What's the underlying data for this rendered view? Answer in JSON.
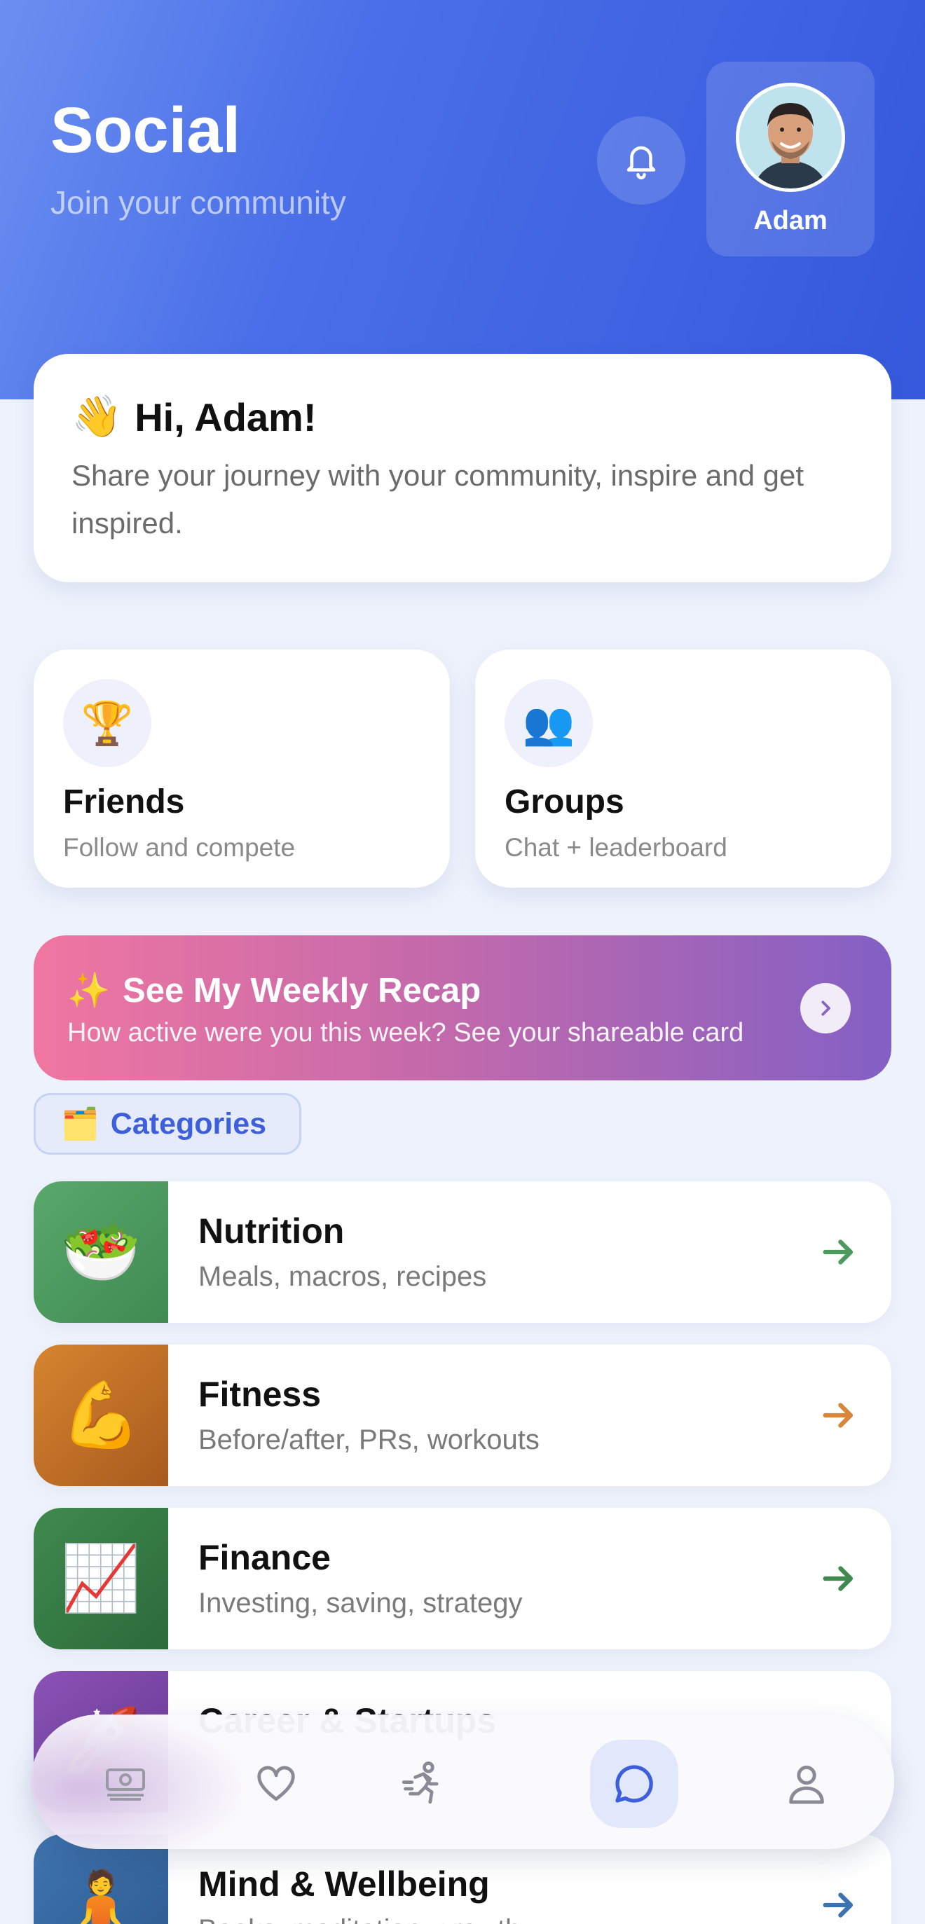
{
  "header": {
    "title": "Social",
    "subtitle": "Join your community",
    "profile_name": "Adam",
    "bell_icon": "bell-icon"
  },
  "greeting": {
    "emoji": "👋",
    "title": "Hi, Adam!",
    "text": "Share your journey with your community, inspire and get inspired."
  },
  "quick_cards": [
    {
      "icon": "🏆",
      "title": "Friends",
      "subtitle": "Follow and compete"
    },
    {
      "icon": "👥",
      "title": "Groups",
      "subtitle": "Chat + leaderboard"
    }
  ],
  "recap": {
    "emoji": "✨",
    "title": "See My Weekly Recap",
    "subtitle": "How active were you this week? See your shareable card"
  },
  "categories_label": "Categories",
  "categories_icon": "🗂️",
  "categories": [
    {
      "emoji": "🥗",
      "title": "Nutrition",
      "subtitle": "Meals, macros, recipes",
      "color": "#4f9e62",
      "arrow_color": "#4c9a5e"
    },
    {
      "emoji": "💪",
      "title": "Fitness",
      "subtitle": "Before/after, PRs, workouts",
      "color": "#c9782a",
      "arrow_color": "#d9853a"
    },
    {
      "emoji": "📈",
      "title": "Finance",
      "subtitle": "Investing, saving, strategy",
      "color": "#3c7f4a",
      "arrow_color": "#3f8a4e"
    },
    {
      "emoji": "🚀",
      "title": "Career & Startups",
      "subtitle": "",
      "color": "#7a45a6",
      "arrow_color": "#7a45a6"
    },
    {
      "emoji": "🧘",
      "title": "Mind & Wellbeing",
      "subtitle": "Books, meditation, growth",
      "color": "#3b6aa5",
      "arrow_color": "#3b72b0"
    }
  ],
  "nav": {
    "items": [
      "money-icon",
      "heart-icon",
      "running-icon",
      "chat-icon",
      "profile-icon"
    ],
    "active": "chat-icon"
  }
}
